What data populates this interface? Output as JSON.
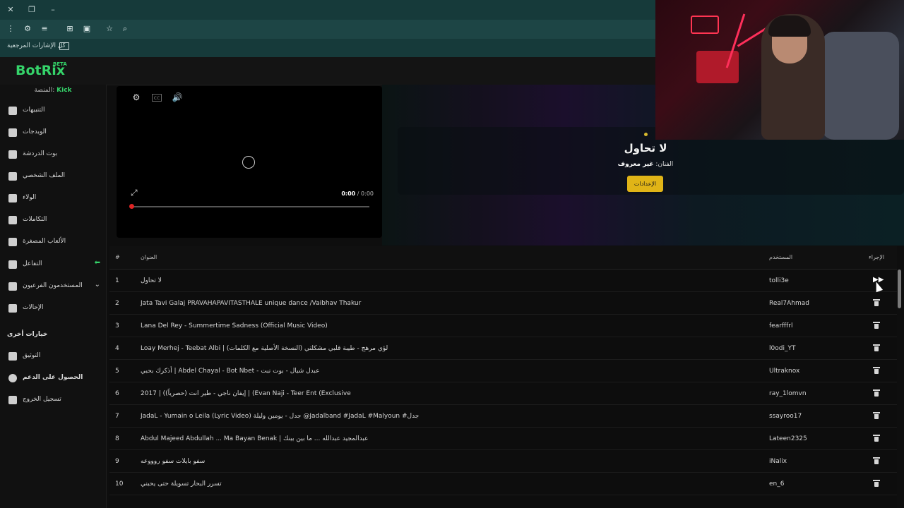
{
  "browser": {
    "bookmarks_label": "كل الإشارات المرجعية"
  },
  "app": {
    "logo": "BotRix",
    "badge": "BETA"
  },
  "sidebar": {
    "platform_label": "المنصة:",
    "platform_value": "Kick",
    "items": [
      {
        "label": "التنبيهات",
        "icon": "alert-icon"
      },
      {
        "label": "الويدجات",
        "icon": "widgets-icon"
      },
      {
        "label": "بوت الدردشة",
        "icon": "robot-icon"
      },
      {
        "label": "الملف الشخصي",
        "icon": "profile-card-icon"
      },
      {
        "label": "الولاء",
        "icon": "trophy-icon"
      },
      {
        "label": "التكاملات",
        "icon": "integrations-icon"
      },
      {
        "label": "الألعاب المصغرة",
        "icon": "gamepad-icon"
      },
      {
        "label": "التفاعل",
        "icon": "music-icon"
      },
      {
        "label": "المستخدمون الفرعيون",
        "icon": "users-icon"
      },
      {
        "label": "الإحالات",
        "icon": "referrals-icon"
      }
    ],
    "more_title": "خيارات أخرى",
    "more_items": [
      {
        "label": "التوثيق",
        "icon": "book-icon"
      },
      {
        "label": "الحصول على الدعم",
        "icon": "help-icon"
      },
      {
        "label": "تسجيل الخروج",
        "icon": "logout-icon"
      }
    ]
  },
  "player": {
    "time_current": "0:00",
    "time_total": "/ 0:00",
    "progress": 0
  },
  "now_playing": {
    "title": "لا تحاول",
    "artist_label": "الفنان:",
    "artist_value": "غير معروف",
    "settings_button": "الإعدادات"
  },
  "queue": {
    "headers": {
      "num": "#",
      "title": "العنوان",
      "user": "المستخدم",
      "action": "الإجراء"
    },
    "rows": [
      {
        "num": "1",
        "title": "لا تحاول",
        "user": "tolli3e"
      },
      {
        "num": "2",
        "title": "Jata Tavi Galaj PRAVAHAPAVITASTHALE unique dance /Vaibhav Thakur",
        "user": "Real7Ahmad"
      },
      {
        "num": "3",
        "title": "Lana Del Rey - Summertime Sadness (Official Music Video)",
        "user": "fearfffrl"
      },
      {
        "num": "4",
        "title": "Loay Merhej - Teebat Albi | (لؤي مرهج - طيبة قلبي مشكلتي (النسخة الأصلية مع الكلمات",
        "user": "l0odi_YT"
      },
      {
        "num": "5",
        "title": "أذكرك بحبي | Abdel Chayal - Bot Nbet - عبدل شيال - بوت نبت",
        "user": "Ultraknox"
      },
      {
        "num": "6",
        "title": "2017 | (إيفان ناجي - طير انت (حصرياً) | (Evan Naji - Teer Ent (Exclusive",
        "user": "ray_1lomvn"
      },
      {
        "num": "7",
        "title": "JadaL - Yumain o Leila (Lyric Video) جدل - يومين وليلة @Jadalband #JadaL #Malyoun #جدل",
        "user": "ssayroo17"
      },
      {
        "num": "8",
        "title": "Abdul Majeed Abdullah ... Ma Bayan Benak | عبدالمجيد عبدالله ... ما بين بينك",
        "user": "Lateen2325"
      },
      {
        "num": "9",
        "title": "سفو بايلات سفو روووعه",
        "user": "iNalix"
      },
      {
        "num": "10",
        "title": "تسرر البحار تسويلة حتى يحبني",
        "user": "en_6"
      }
    ]
  },
  "colors": {
    "accent": "#35d46a",
    "settings_button": "#e0b417",
    "progress": "#e02424",
    "titlebar": "#163a3a"
  }
}
